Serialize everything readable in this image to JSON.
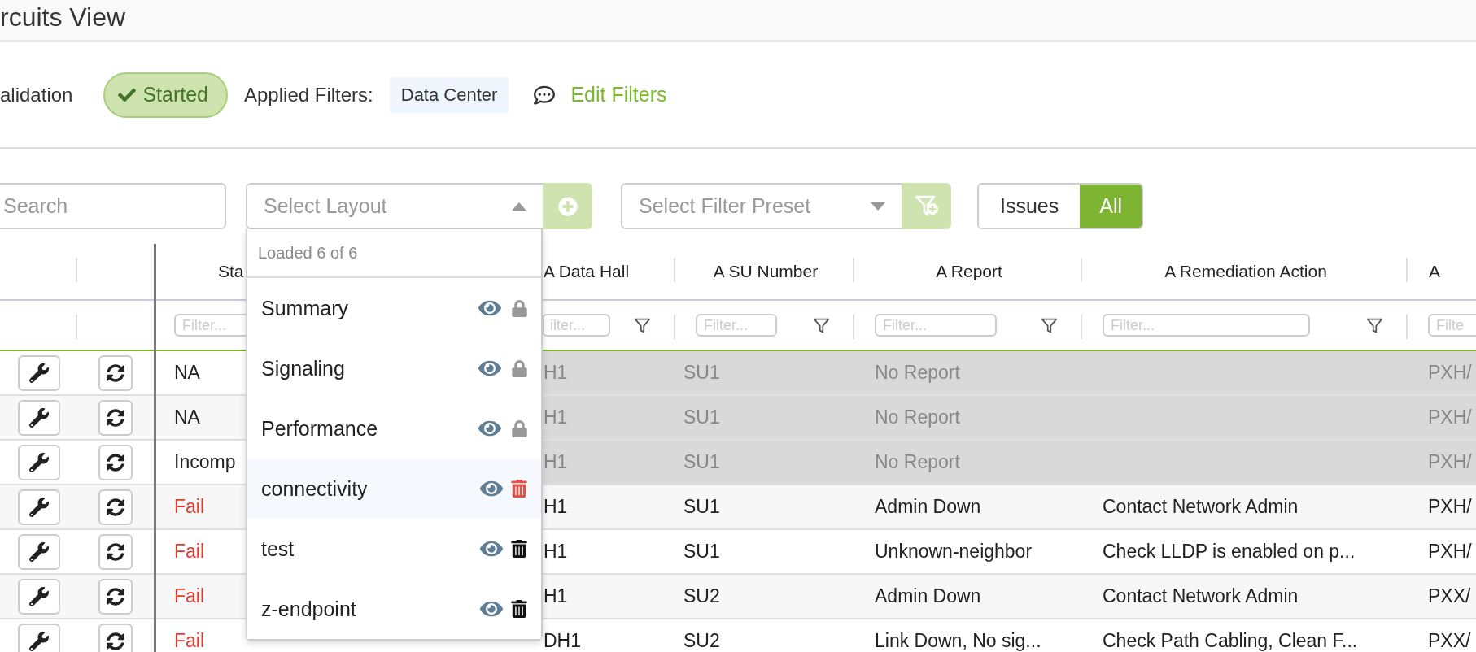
{
  "header": {
    "title": "rcuits View"
  },
  "validation": {
    "label": "alidation",
    "status": "Started",
    "applied_label": "Applied Filters:",
    "filters": [
      "Data Center"
    ],
    "edit_label": "Edit Filters"
  },
  "toolbar": {
    "search": {
      "placeholder": "Search"
    },
    "layout_select": {
      "placeholder": "Select Layout",
      "expanded": true
    },
    "preset_select": {
      "placeholder": "Select Filter Preset",
      "expanded": false
    },
    "toggle": [
      {
        "label": "Issues",
        "selected": false
      },
      {
        "label": "All",
        "selected": true
      }
    ]
  },
  "layout_menu": {
    "header": "Loaded 6 of 6",
    "items": [
      {
        "label": "Summary",
        "locked": true,
        "highlighted": false
      },
      {
        "label": "Signaling",
        "locked": true,
        "highlighted": false
      },
      {
        "label": "Performance",
        "locked": true,
        "highlighted": false
      },
      {
        "label": "connectivity",
        "locked": false,
        "highlighted": true
      },
      {
        "label": "test",
        "locked": false,
        "highlighted": false
      },
      {
        "label": "z-endpoint",
        "locked": false,
        "highlighted": false
      }
    ]
  },
  "table": {
    "columns": [
      {
        "title": "Sta",
        "filter_placeholder": "Filter..."
      },
      {},
      {
        "title": "A Data Hall",
        "filter_placeholder": "ilter...",
        "funnel": true
      },
      {
        "title": "A SU Number",
        "filter_placeholder": "Filter...",
        "funnel": true
      },
      {
        "title": "A Report",
        "filter_placeholder": "Filter...",
        "funnel": true
      },
      {
        "title": "A Remediation Action",
        "filter_placeholder": "Filter...",
        "funnel": true
      },
      {
        "title": "A",
        "filter_placeholder": "Filte",
        "funnel": false
      }
    ],
    "rows": [
      {
        "muted": true,
        "failed": false,
        "status": "NA",
        "data_hall": "H1",
        "su_number": "SU1",
        "report": "No Report",
        "column_9": "PXH/"
      },
      {
        "muted": true,
        "failed": false,
        "status": "NA",
        "data_hall": "H1",
        "su_number": "SU1",
        "report": "No Report",
        "column_9": "PXH/"
      },
      {
        "muted": true,
        "failed": false,
        "status": "Incomp",
        "data_hall": "H1",
        "su_number": "SU1",
        "report": "No Report",
        "column_9": "PXH/"
      },
      {
        "muted": false,
        "failed": true,
        "status": "Fail",
        "data_hall": "H1",
        "su_number": "SU1",
        "report": "Admin Down",
        "remediation": "Contact Network Admin",
        "column_9": "PXH/"
      },
      {
        "muted": false,
        "failed": true,
        "status": "Fail",
        "data_hall": "H1",
        "su_number": "SU1",
        "report": "Unknown-neighbor",
        "remediation": "Check LLDP is enabled on p...",
        "column_9": "PXH/"
      },
      {
        "muted": false,
        "failed": true,
        "status": "Fail",
        "data_hall": "H1",
        "su_number": "SU2",
        "report": "Admin Down",
        "remediation": "Contact Network Admin",
        "column_9": "PXX/"
      },
      {
        "muted": false,
        "failed": true,
        "status": "Fail",
        "data_hall": "DH1",
        "su_number": "SU2",
        "report": "Link Down, No sig...",
        "remediation": "Check Path Cabling, Clean F...",
        "column_9": "PXX/"
      }
    ]
  }
}
